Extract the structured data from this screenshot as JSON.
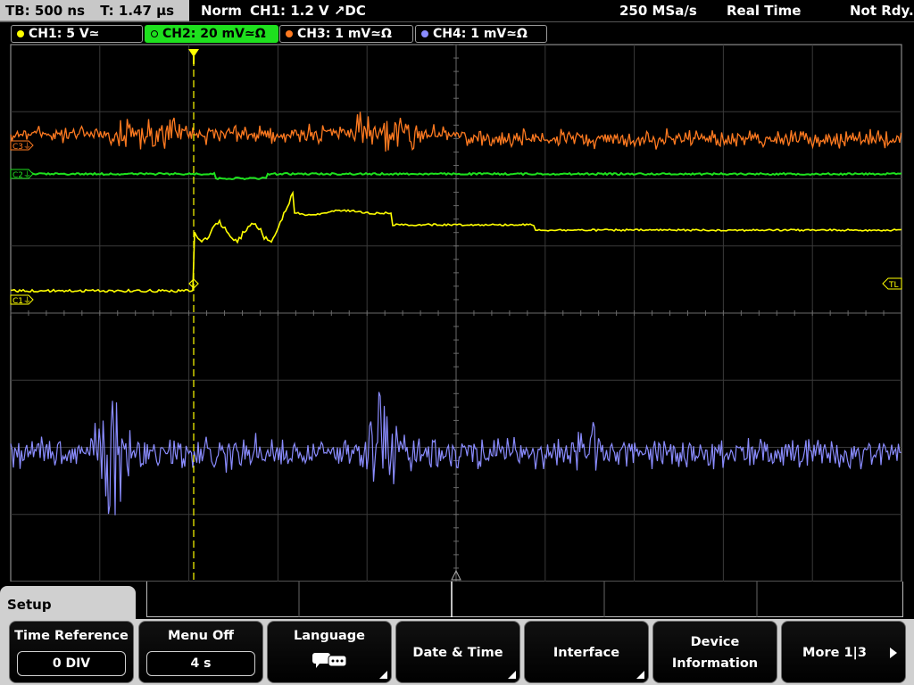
{
  "status_bar": {
    "timebase": "TB: 500 ns",
    "trigger_time": "T: 1.47 µs",
    "mode": "Norm",
    "trigger_source": "CH1: 1.2 V ↗DC",
    "sample_rate": "250 MSa/s",
    "acquisition": "Real Time",
    "state": "Not Rdy."
  },
  "channels": [
    {
      "label": "CH1: 5 V≃",
      "color": "#ffff00"
    },
    {
      "label": "CH2: 20 mV≃Ω",
      "color": "#1ee01e",
      "active": true
    },
    {
      "label": "CH3: 1 mV≃Ω",
      "color": "#ff7a20"
    },
    {
      "label": "CH4: 1 mV≃Ω",
      "color": "#8a8cff"
    }
  ],
  "screen_markers": {
    "c3": "C3⏚",
    "c2": "C2⏚",
    "c1": "C1⏚",
    "trigger_level": "TL"
  },
  "menu": {
    "title": "Setup",
    "softkeys": [
      {
        "label": "Time Reference",
        "value": "0 DIV"
      },
      {
        "label": "Menu Off",
        "value": "4 s"
      },
      {
        "label": "Language",
        "icon": "speech-bubbles-icon"
      },
      {
        "label": "Date & Time"
      },
      {
        "label": "Interface"
      },
      {
        "label": "Device",
        "label2": "Information"
      },
      {
        "label": "More 1|3",
        "icon": "arrow-right-icon"
      }
    ]
  }
}
